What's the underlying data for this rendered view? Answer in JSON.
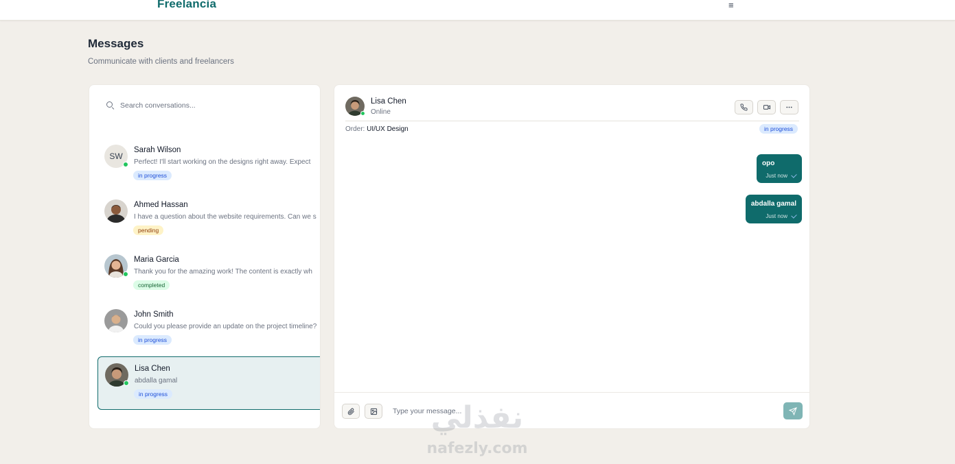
{
  "app": {
    "brand": "Freelancia",
    "menu_icon": "hamburger-icon"
  },
  "page": {
    "title": "Messages",
    "subtitle": "Communicate with clients and freelancers"
  },
  "search": {
    "placeholder": "Search conversations..."
  },
  "conversations": [
    {
      "name": "Sarah Wilson",
      "initials": "SW",
      "preview": "Perfect! I'll start working on the designs right away. Expect",
      "status": "in progress",
      "online": true
    },
    {
      "name": "Ahmed Hassan",
      "preview": "I have a question about the website requirements. Can we s",
      "status": "pending",
      "online": false
    },
    {
      "name": "Maria Garcia",
      "preview": "Thank you for the amazing work! The content is exactly wh",
      "status": "completed",
      "online": true
    },
    {
      "name": "John Smith",
      "preview": "Could you please provide an update on the project timeline?",
      "status": "in progress",
      "online": false
    },
    {
      "name": "Lisa Chen",
      "preview": "abdalla gamal",
      "status": "in progress",
      "online": true,
      "active": true
    }
  ],
  "chat": {
    "name": "Lisa Chen",
    "status": "Online",
    "order_label": "Order:",
    "order_value": "UI/UX Design",
    "order_status": "in progress",
    "messages": [
      {
        "text": "opo",
        "time": "Just now"
      },
      {
        "text": "abdalla gamal",
        "time": "Just now"
      }
    ],
    "composer_placeholder": "Type your message..."
  },
  "colors": {
    "brand": "#0f6b6b",
    "background": "#f2efea",
    "online": "#22c55e"
  },
  "watermark": {
    "arabic": "نفذلي",
    "latin": "nafezly.com"
  }
}
